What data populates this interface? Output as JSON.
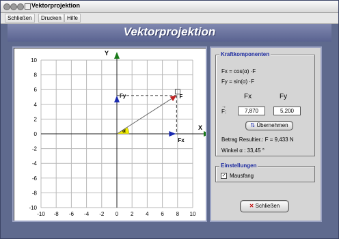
{
  "window": {
    "title": "Vektorprojektion"
  },
  "menu": [
    "Schließen",
    "Drucken",
    "Hilfe"
  ],
  "banner": {
    "title": "Vektorprojektion"
  },
  "plot": {
    "xlim": [
      -10,
      10
    ],
    "ylim": [
      -10,
      10
    ],
    "x_ticks": [
      "-10",
      "-8",
      "-6",
      "-4",
      "-2",
      "0",
      "2",
      "4",
      "6",
      "8",
      "10"
    ],
    "y_ticks": [
      "10",
      "8",
      "6",
      "4",
      "2",
      "0",
      "-2",
      "-4",
      "-6",
      "-8",
      "-10"
    ],
    "axis_y_label": "Y",
    "axis_x_label": "X",
    "vector": {
      "fx": 7.87,
      "fy": 5.2
    },
    "labels": {
      "f": "F",
      "fx": "Fx",
      "fy": "Fy",
      "alpha": "α"
    },
    "colors": {
      "grid": "#b8b8b8",
      "axis": "#202020",
      "y_arrow": "#1a7a1a",
      "x_arrow": "#1a7a1a",
      "vector": "#c02020",
      "component": "#1a2ab0",
      "angle": "#f2ee00"
    }
  },
  "kraft": {
    "legend": "Kraftkomponenten",
    "formula_fx": "Fx = cos(α) ·F",
    "formula_fy": "Fy = sin(α) ·F",
    "col_fx": "Fx",
    "col_fy": "Fy",
    "row_label": "F:",
    "fx_value": "7,870",
    "fy_value": "5,200",
    "apply_button": "Übernehmen",
    "betrag": "Betrag Resultier.: F = 9,433 N",
    "winkel": "Winkel α : 33,45 °"
  },
  "einstellungen": {
    "legend": "Einstellungen",
    "mausfang_label": "Mausfang",
    "mausfang_checked": true
  },
  "close_button": "Schließen"
}
